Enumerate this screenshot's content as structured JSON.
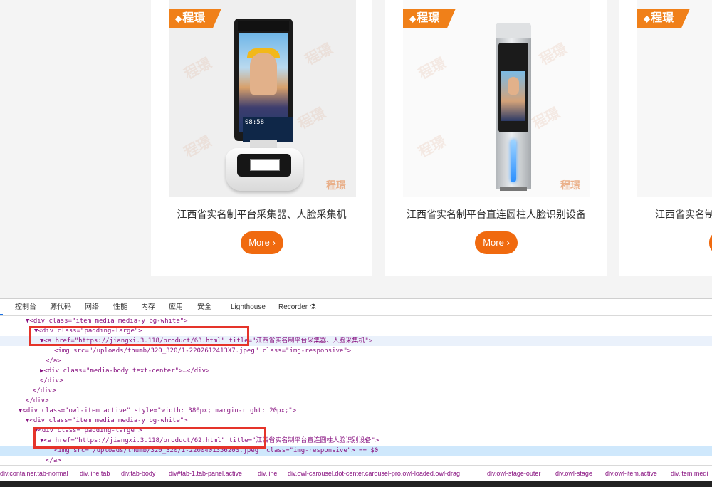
{
  "products": [
    {
      "brand": "程璟",
      "title": "江西省实名制平台采集器、人脸采集机",
      "more": "More ›",
      "device_time": "08:58"
    },
    {
      "brand": "程璟",
      "title": "江西省实名制平台直连圆柱人脸识别设备",
      "more": "More ›"
    },
    {
      "brand": "程璟",
      "title": "江西省实名制",
      "more": ""
    }
  ],
  "watermark": "程璟",
  "devtools": {
    "tabs": [
      "控制台",
      "源代码",
      "网络",
      "性能",
      "内存",
      "应用",
      "安全",
      "Lighthouse",
      "Recorder"
    ],
    "lines": [
      {
        "text": "▼<div class=\"item media media-y bg-white\">"
      },
      {
        "text": "▼<div class=\"padding-large\">"
      },
      {
        "text": "▼<a href=\"https://jiangxi.3.118/product/63.html\" title=\"江西省实名制平台采集器、人脸采集机\">"
      },
      {
        "text": "<img src=\"/uploads/thumb/320_320/1-2202612413X7.jpeg\" class=\"img-responsive\">"
      },
      {
        "text": "</a>"
      },
      {
        "text": "▶<div class=\"media-body text-center\">…</div>"
      },
      {
        "text": "</div>"
      },
      {
        "text": "</div>"
      },
      {
        "text": "</div>"
      },
      {
        "text": "▼<div class=\"owl-item active\" style=\"width: 380px; margin-right: 20px;\">"
      },
      {
        "text": "▼<div class=\"item media media-y bg-white\">"
      },
      {
        "text": "▼<div class=\"padding-large\">"
      },
      {
        "text": "▼<a href=\"https://jiangxi.3.118/product/62.html\" title=\"江西省实名制平台直连圆柱人脸识别设备\">"
      },
      {
        "text": "<img src=\"/uploads/thumb/320_320/1-2200401356203.jpeg\" class=\"img-responsive\"> == $0"
      },
      {
        "text": "</a>"
      }
    ],
    "breadcrumbs": [
      "div.container.tab-normal",
      "div.line.tab",
      "div.tab-body",
      "div#tab-1.tab-panel.active",
      "div.line",
      "div.owl-carousel.dot-center.carousel-pro.owl-loaded.owl-drag",
      "div.owl-stage-outer",
      "div.owl-stage",
      "div.owl-item.active",
      "div.item.medi"
    ]
  },
  "colors": {
    "accent": "#f06a0f",
    "highlight_box": "#e5342a",
    "brand_tag": "#f08019"
  }
}
